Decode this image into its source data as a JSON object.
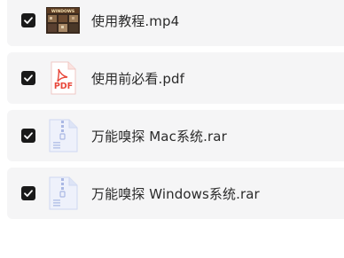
{
  "files": [
    {
      "name": "使用教程.mp4",
      "type": "video",
      "selected": true,
      "thumbnail_text": "WINDOWS"
    },
    {
      "name": "使用前必看.pdf",
      "type": "pdf",
      "selected": true,
      "icon_label": "PDF"
    },
    {
      "name": "万能嗅探 Mac系统.rar",
      "type": "archive",
      "selected": true
    },
    {
      "name": "万能嗅探 Windows系统.rar",
      "type": "archive",
      "selected": true
    }
  ],
  "colors": {
    "row_background": "#f5f5f6",
    "checkbox": "#1a1a1a",
    "pdf_red": "#e8473a",
    "archive_blue": "#b9c6ea"
  }
}
